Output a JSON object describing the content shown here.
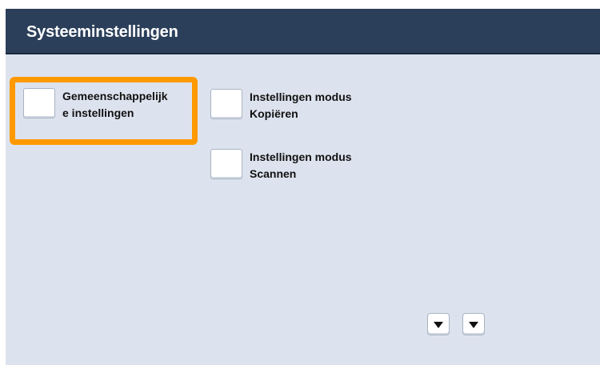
{
  "header": {
    "title": "Systeeminstellingen"
  },
  "options": [
    {
      "label_line1": "Gemeenschappelijk",
      "label_line2": "e instellingen",
      "highlighted": true
    },
    {
      "label_line1": "Instellingen modus",
      "label_line2": "Kopiëren",
      "highlighted": false
    },
    {
      "label_line1": "Instellingen modus",
      "label_line2": "Scannen",
      "highlighted": false
    }
  ],
  "scroll": {
    "icon_left": "scroll-down-icon",
    "icon_right": "scroll-down-icon"
  },
  "colors": {
    "titlebar": "#2b3f5a",
    "background": "#dde3ee",
    "highlight": "#ff9900"
  }
}
